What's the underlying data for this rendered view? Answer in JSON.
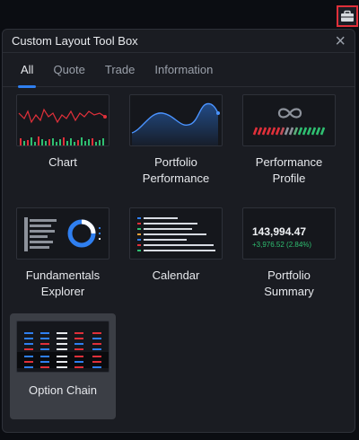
{
  "panel": {
    "title": "Custom Layout Tool Box",
    "close_glyph": "×"
  },
  "tabs": [
    {
      "label": "All",
      "active": true
    },
    {
      "label": "Quote",
      "active": false
    },
    {
      "label": "Trade",
      "active": false
    },
    {
      "label": "Information",
      "active": false
    }
  ],
  "tiles": {
    "chart": {
      "label": "Chart"
    },
    "portfolio_performance": {
      "label_line1": "Portfolio",
      "label_line2": "Performance"
    },
    "performance_profile": {
      "label_line1": "Performance",
      "label_line2": "Profile"
    },
    "fundamentals_explorer": {
      "label_line1": "Fundamentals",
      "label_line2": "Explorer"
    },
    "calendar": {
      "label": "Calendar"
    },
    "portfolio_summary": {
      "label_line1": "Portfolio",
      "label_line2": "Summary",
      "value": "143,994.47",
      "change": "+3,976.52 (2.84%)"
    },
    "option_chain": {
      "label": "Option Chain"
    }
  },
  "colors": {
    "accent": "#2f7ff0",
    "red": "#e0303a",
    "green": "#2fbf71",
    "panel_bg": "#1a1c22"
  },
  "icons": {
    "toolbox": "briefcase-icon",
    "close": "close-icon",
    "infinity": "infinity-icon"
  }
}
